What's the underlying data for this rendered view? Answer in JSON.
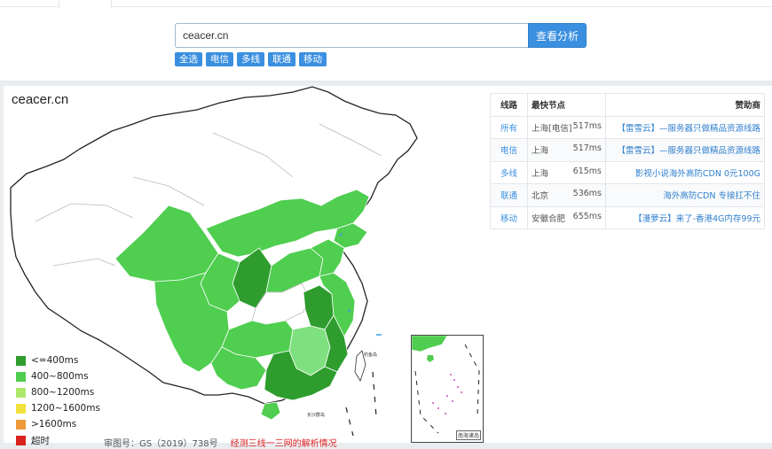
{
  "search": {
    "value": "ceacer.cn",
    "button_label": "查看分析"
  },
  "filters": [
    "全选",
    "电信",
    "多线",
    "联通",
    "移动"
  ],
  "map": {
    "title": "ceacer.cn",
    "legend": [
      {
        "label": "<=400ms",
        "color": "#2e9d2e"
      },
      {
        "label": "400~800ms",
        "color": "#4fce4f"
      },
      {
        "label": "800~1200ms",
        "color": "#aee86b"
      },
      {
        "label": "1200~1600ms",
        "color": "#f2e13c"
      },
      {
        "label": ">1600ms",
        "color": "#ee9a3a"
      },
      {
        "label": "超时",
        "color": "#d8231f"
      }
    ],
    "footnote_left": "审图号：GS（2019）738号",
    "footnote_right": "经测三线一三网的解析情况"
  },
  "table": {
    "headers": {
      "line": "线路",
      "node": "最快节点",
      "sponsor": "赞助商"
    },
    "rows": [
      {
        "line": "所有",
        "node": "上海[电信]",
        "ms": "517ms",
        "sponsor": "【雷雪云】—服务器只做精品资源线路"
      },
      {
        "line": "电信",
        "node": "上海",
        "ms": "517ms",
        "sponsor": "【雷雪云】—服务器只做精品资源线路"
      },
      {
        "line": "多线",
        "node": "上海",
        "ms": "615ms",
        "sponsor": "影视小说海外高防CDN 0元100G"
      },
      {
        "line": "联通",
        "node": "北京",
        "ms": "536ms",
        "sponsor": "海外高防CDN 专接扛不住"
      },
      {
        "line": "移动",
        "node": "安徽合肥",
        "ms": "655ms",
        "sponsor": "【漫萝云】来了-香港4G内存99元"
      }
    ]
  }
}
